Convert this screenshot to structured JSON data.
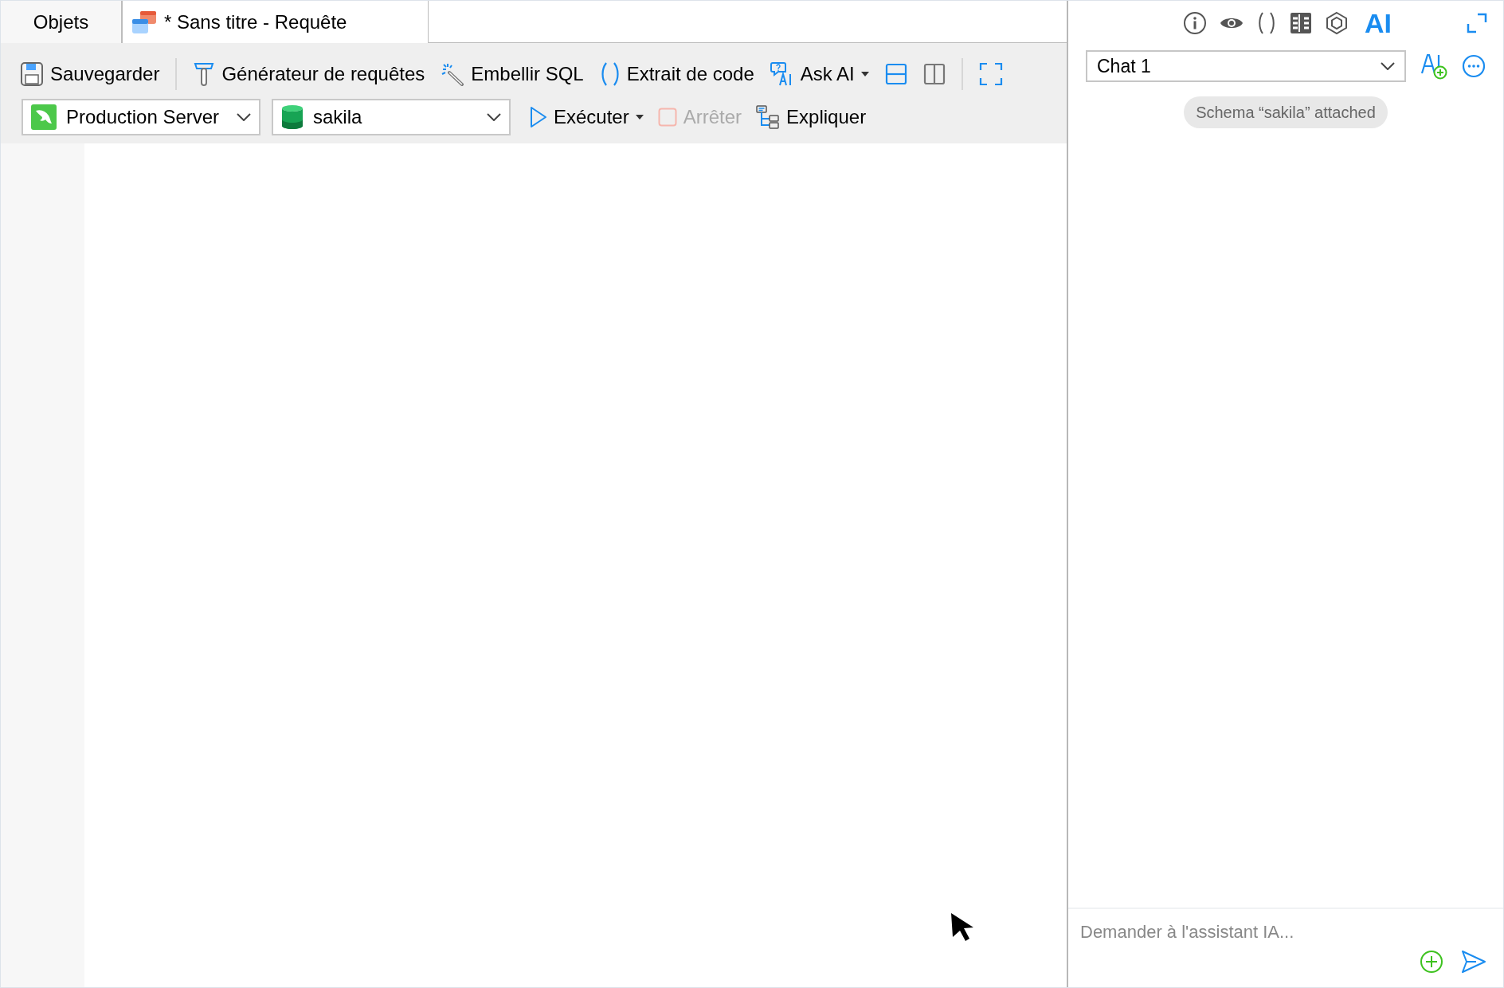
{
  "tabs": [
    {
      "label": "Objets",
      "kind": "plain",
      "selected": false
    },
    {
      "label": "* Sans titre - Requête",
      "kind": "query",
      "selected": true
    }
  ],
  "toolbar": [
    {
      "kind": "save",
      "label": "Sauvegarder"
    },
    {
      "kind": "separator"
    },
    {
      "kind": "builder",
      "label": "Générateur de requêtes"
    },
    {
      "kind": "beautify",
      "label": "Embellir SQL"
    },
    {
      "kind": "snippet",
      "label": "Extrait de code"
    },
    {
      "kind": "askai",
      "label": "Ask AI",
      "dropdown": true
    },
    {
      "kind": "split-h",
      "selected": true
    },
    {
      "kind": "split-v",
      "selected": false
    },
    {
      "kind": "separator"
    },
    {
      "kind": "fullscreen"
    }
  ],
  "connection": {
    "value": "Production Server"
  },
  "database": {
    "value": "sakila"
  },
  "actions": [
    {
      "kind": "run",
      "label": "Exécuter",
      "dropdown": true,
      "disabled": false
    },
    {
      "kind": "stop",
      "label": "Arrêter",
      "disabled": true
    },
    {
      "kind": "explain",
      "label": "Expliquer",
      "disabled": false
    }
  ],
  "side_panel": {
    "tabs": [
      {
        "kind": "info",
        "selected": false
      },
      {
        "kind": "preview",
        "selected": false
      },
      {
        "kind": "parens",
        "selected": false
      },
      {
        "kind": "grid",
        "selected": false
      },
      {
        "kind": "hexagon",
        "selected": false
      },
      {
        "kind": "ai",
        "label": "AI",
        "selected": true
      }
    ],
    "chat_select": {
      "value": "Chat 1"
    },
    "context_badge": "Schema “sakila” attached",
    "input": {
      "placeholder": "Demander à l'assistant IA..."
    }
  }
}
